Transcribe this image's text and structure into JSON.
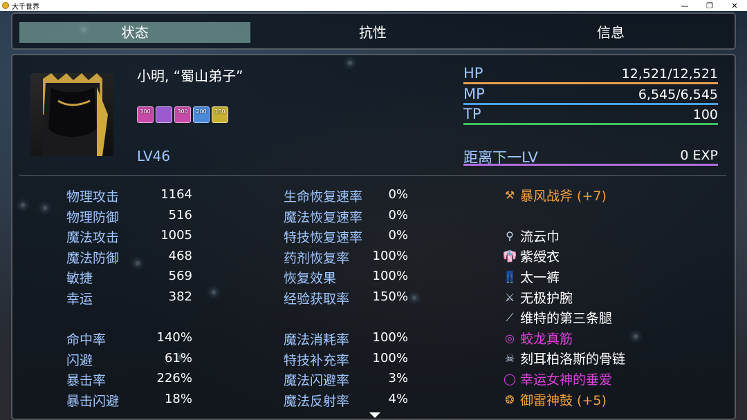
{
  "window": {
    "title": "大千世界"
  },
  "tabs": [
    {
      "label": "状态",
      "active": true
    },
    {
      "label": "抗性",
      "active": false
    },
    {
      "label": "信息",
      "active": false
    }
  ],
  "character": {
    "name": "小明, “蜀山弟子”",
    "level": "LV46",
    "buffs": [
      {
        "value": "300",
        "color": "#c84aa8"
      },
      {
        "value": "",
        "color": "#9b5ad0"
      },
      {
        "value": "300",
        "color": "#c84aa8"
      },
      {
        "value": "200",
        "color": "#4a8ad8"
      },
      {
        "value": "150",
        "color": "#c8b030"
      }
    ]
  },
  "gauges": [
    {
      "label": "HP",
      "value": "12,521/12,521",
      "fill": 1.0,
      "color": "#e8a050"
    },
    {
      "label": "MP",
      "value": "6,545/6,545",
      "fill": 1.0,
      "color": "#4aa0e8"
    },
    {
      "label": "TP",
      "value": "100",
      "fill": 1.0,
      "color": "#40c060"
    }
  ],
  "exp": {
    "label": "距离下一LV",
    "value": "0 EXP",
    "fill": 1.0,
    "color": "#b070e0"
  },
  "stats_left": [
    {
      "label": "物理攻击",
      "value": "1164"
    },
    {
      "label": "物理防御",
      "value": "516"
    },
    {
      "label": "魔法攻击",
      "value": "1005"
    },
    {
      "label": "魔法防御",
      "value": "468"
    },
    {
      "label": "敏捷",
      "value": "569"
    },
    {
      "label": "幸运",
      "value": "382"
    }
  ],
  "stats_left2": [
    {
      "label": "命中率",
      "value": "140%"
    },
    {
      "label": "闪避",
      "value": "61%"
    },
    {
      "label": "暴击率",
      "value": "226%"
    },
    {
      "label": "暴击闪避",
      "value": "18%"
    }
  ],
  "stats_mid": [
    {
      "label": "生命恢复速率",
      "value": "0%"
    },
    {
      "label": "魔法恢复速率",
      "value": "0%"
    },
    {
      "label": "特技恢复速率",
      "value": "0%"
    },
    {
      "label": "药剂恢复率",
      "value": "100%"
    },
    {
      "label": "恢复效果",
      "value": "100%"
    },
    {
      "label": "经验获取率",
      "value": "150%"
    }
  ],
  "stats_mid2": [
    {
      "label": "魔法消耗率",
      "value": "100%"
    },
    {
      "label": "特技补充率",
      "value": "100%"
    },
    {
      "label": "魔法闪避率",
      "value": "3%"
    },
    {
      "label": "魔法反射率",
      "value": "4%"
    }
  ],
  "equipment": [
    {
      "name": "暴风战斧 (+7)",
      "color": "#f0a040",
      "icon": "axe-icon",
      "glyph": "⚒"
    },
    {
      "name": "",
      "color": "#ffffff",
      "icon": "",
      "glyph": ""
    },
    {
      "name": "流云巾",
      "color": "#ffffff",
      "icon": "headband-icon",
      "glyph": "⚲"
    },
    {
      "name": "紫绶衣",
      "color": "#ffffff",
      "icon": "robe-icon",
      "glyph": "👘"
    },
    {
      "name": "太一裤",
      "color": "#ffffff",
      "icon": "pants-icon",
      "glyph": "👖"
    },
    {
      "name": "无极护腕",
      "color": "#ffffff",
      "icon": "bracer-icon",
      "glyph": "⚔"
    },
    {
      "name": "维特的第三条腿",
      "color": "#ffffff",
      "icon": "bone-icon",
      "glyph": "⟋"
    },
    {
      "name": "蛟龙真筋",
      "color": "#e040e0",
      "icon": "ring-icon",
      "glyph": "◎"
    },
    {
      "name": "刻耳柏洛斯的骨链",
      "color": "#ffffff",
      "icon": "necklace-icon",
      "glyph": "☠"
    },
    {
      "name": "幸运女神的垂爱",
      "color": "#e040e0",
      "icon": "gold-ring-icon",
      "glyph": "◯"
    },
    {
      "name": "御雷神鼓 (+5)",
      "color": "#f0a040",
      "icon": "drum-icon",
      "glyph": "❂"
    }
  ]
}
